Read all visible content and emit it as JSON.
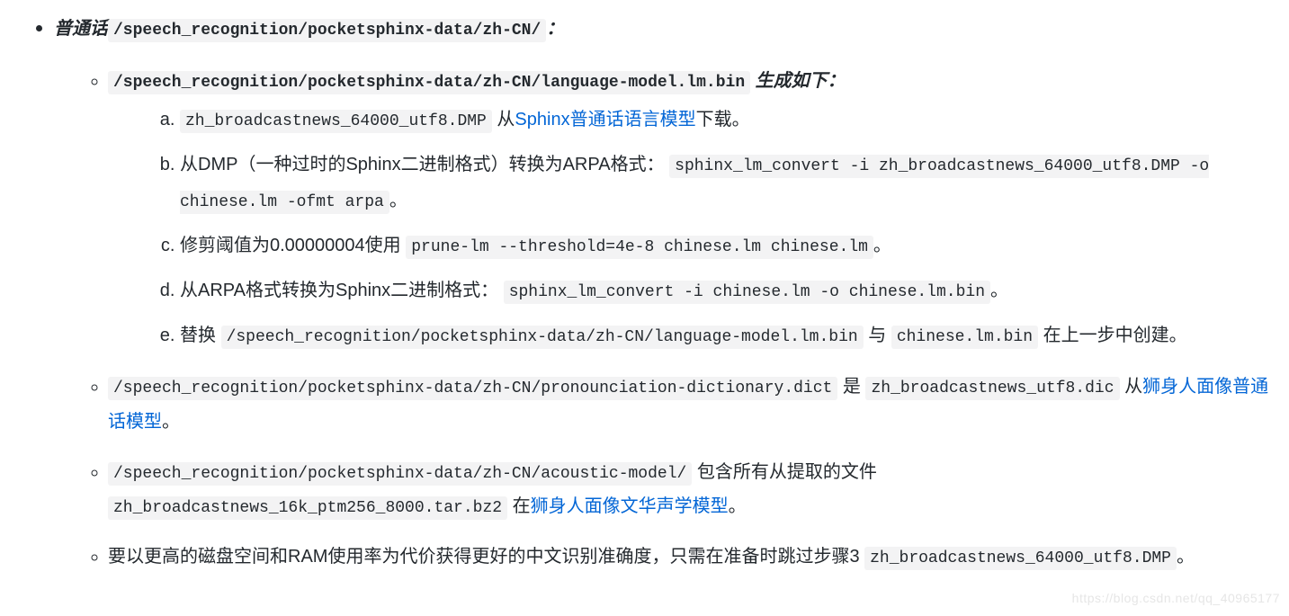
{
  "top": {
    "label": "普通话",
    "code": "/speech_recognition/pocketsphinx-data/zh-CN/",
    "suffix": "："
  },
  "sub1": {
    "code": "/speech_recognition/pocketsphinx-data/zh-CN/language-model.lm.bin",
    "suffix": " 生成如下："
  },
  "steps": {
    "a": {
      "code": "zh_broadcastnews_64000_utf8.DMP",
      "t1": " 从",
      "link": "Sphinx普通话语言模型",
      "t2": "下载。"
    },
    "b": {
      "t1": "从DMP（一种过时的Sphinx二进制格式）转换为ARPA格式：",
      "code": "sphinx_lm_convert -i zh_broadcastnews_64000_utf8.DMP -o chinese.lm -ofmt arpa",
      "t2": "。"
    },
    "c": {
      "t1": "修剪阈值为0.00000004使用 ",
      "code": "prune-lm --threshold=4e-8 chinese.lm chinese.lm",
      "t2": "。"
    },
    "d": {
      "t1": "从ARPA格式转换为Sphinx二进制格式：",
      "code": "sphinx_lm_convert -i chinese.lm -o chinese.lm.bin",
      "t2": "。"
    },
    "e": {
      "t1": "替换 ",
      "code1": "/speech_recognition/pocketsphinx-data/zh-CN/language-model.lm.bin",
      "t2": " 与 ",
      "code2": "chinese.lm.bin",
      "t3": " 在上一步中创建。"
    }
  },
  "sub2": {
    "code1": "/speech_recognition/pocketsphinx-data/zh-CN/pronounciation-dictionary.dict",
    "t1": " 是 ",
    "code2": "zh_broadcastnews_utf8.dic",
    "t2": " 从",
    "link": "狮身人面像普通话模型",
    "t3": "。"
  },
  "sub3": {
    "code1": "/speech_recognition/pocketsphinx-data/zh-CN/acoustic-model/",
    "t1": " 包含所有从提取的文件 ",
    "code2": "zh_broadcastnews_16k_ptm256_8000.tar.bz2",
    "t2": " 在",
    "link": "狮身人面像文华声学模型",
    "t3": "。"
  },
  "sub4": {
    "t1": "要以更高的磁盘空间和RAM使用率为代价获得更好的中文识别准确度，只需在准备时跳过步骤3 ",
    "code": "zh_broadcastnews_64000_utf8.DMP",
    "t2": "。"
  },
  "watermark": "https://blog.csdn.net/qq_40965177"
}
